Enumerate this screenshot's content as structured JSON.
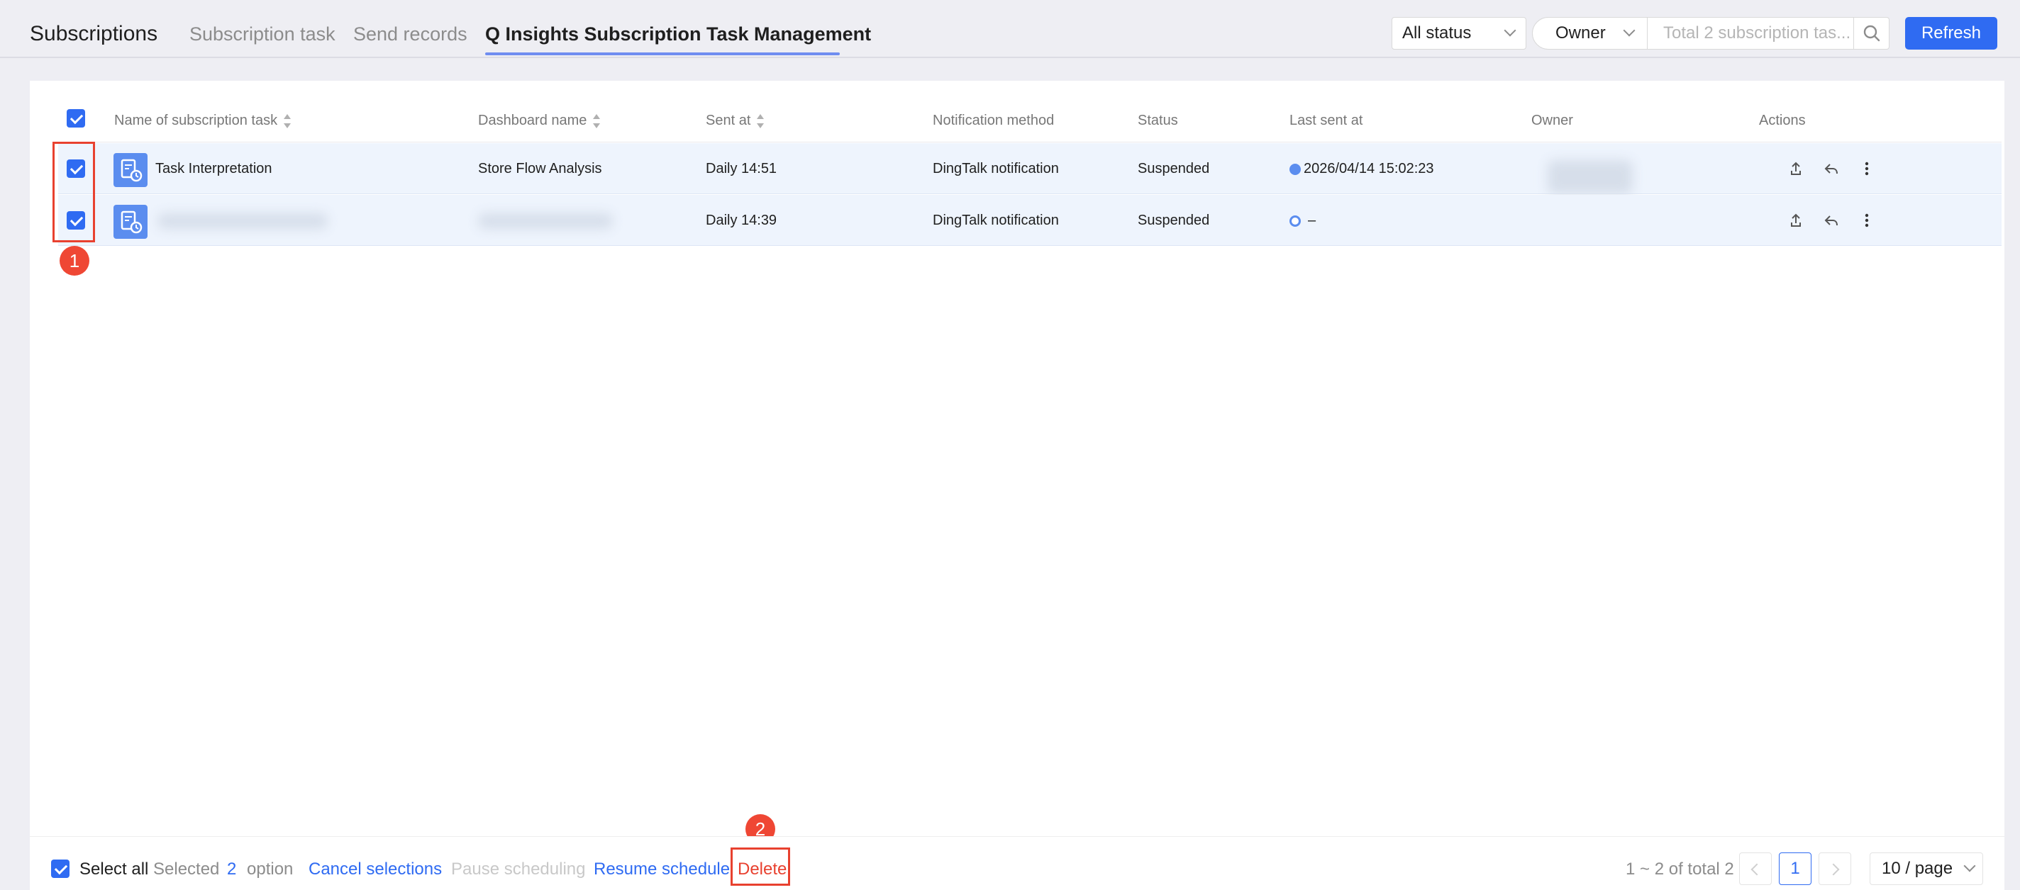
{
  "header": {
    "app_title": "Subscriptions",
    "tabs": [
      {
        "label": "Subscription task",
        "active": false
      },
      {
        "label": "Send records",
        "active": false
      },
      {
        "label": "Q Insights Subscription Task Management",
        "active": true
      }
    ],
    "status_filter": "All status",
    "owner_filter": "Owner",
    "search_placeholder": "Total 2 subscription tas...",
    "refresh_label": "Refresh"
  },
  "table": {
    "columns": [
      "Name of subscription task",
      "Dashboard name",
      "Sent at",
      "Notification method",
      "Status",
      "Last sent at",
      "Owner",
      "Actions"
    ],
    "rows": [
      {
        "name": "Task Interpretation",
        "dashboard": "Store Flow Analysis",
        "sent_at": "Daily 14:51",
        "method": "DingTalk notification",
        "status": "Suspended",
        "last_sent": "2026/04/14 15:02:23"
      },
      {
        "name": "",
        "dashboard": "",
        "sent_at": "Daily 14:39",
        "method": "DingTalk notification",
        "status": "Suspended",
        "last_sent": "–"
      }
    ]
  },
  "annotations": {
    "step1": "1",
    "step2": "2"
  },
  "footer": {
    "select_all": "Select all",
    "selected_prefix": "Selected",
    "selected_count": "2",
    "selected_suffix": "option",
    "cancel": "Cancel selections",
    "pause": "Pause scheduling",
    "resume": "Resume schedule",
    "delete": "Delete",
    "range": "1 ~ 2 of total 2",
    "current_page": "1",
    "page_size": "10 / page"
  },
  "colors": {
    "accent": "#2f6bf2",
    "annotation": "#e8412f",
    "selected_row": "#eef4fd"
  }
}
